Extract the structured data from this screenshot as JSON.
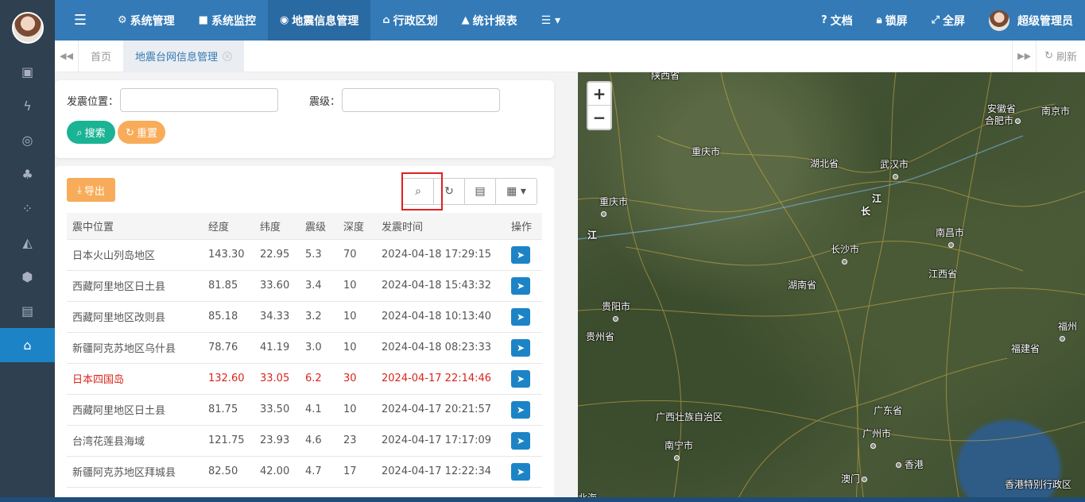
{
  "sidebar": {
    "icons": [
      "money-icon",
      "bolt-icon",
      "circle-dot-icon",
      "tree-icon",
      "grid-dots-icon",
      "area-chart-icon",
      "cube-icon",
      "newspaper-icon",
      "bank-icon"
    ]
  },
  "topnav": {
    "items": [
      {
        "icon": "⚙",
        "label": "系统管理"
      },
      {
        "icon": "■",
        "label": "系统监控"
      },
      {
        "icon": "◉",
        "label": "地震信息管理"
      },
      {
        "icon": "⌂",
        "label": "行政区划"
      },
      {
        "icon": "▲",
        "label": "统计报表"
      }
    ],
    "more_icon": "☰ ▾",
    "docs": "文档",
    "lock": "锁屏",
    "fullscreen": "全屏",
    "user": "超级管理员"
  },
  "tabs": {
    "home": "首页",
    "current": "地震台网信息管理",
    "refresh": "刷新"
  },
  "search": {
    "location_label": "发震位置：",
    "location_value": "",
    "magnitude_label": "震级：",
    "magnitude_value": "",
    "search_btn": "搜索",
    "reset_btn": "重置"
  },
  "table": {
    "export_btn": "导出",
    "columns": [
      "震中位置",
      "经度",
      "纬度",
      "震级",
      "深度",
      "发震时间",
      "操作"
    ],
    "rows": [
      {
        "location": "日本火山列岛地区",
        "lon": "143.30",
        "lat": "22.95",
        "mag": "5.3",
        "depth": "70",
        "time": "2024-04-18 17:29:15"
      },
      {
        "location": "西藏阿里地区日土县",
        "lon": "81.85",
        "lat": "33.60",
        "mag": "3.4",
        "depth": "10",
        "time": "2024-04-18 15:43:32"
      },
      {
        "location": "西藏阿里地区改则县",
        "lon": "85.18",
        "lat": "34.33",
        "mag": "3.2",
        "depth": "10",
        "time": "2024-04-18 10:13:40"
      },
      {
        "location": "新疆阿克苏地区乌什县",
        "lon": "78.76",
        "lat": "41.19",
        "mag": "3.0",
        "depth": "10",
        "time": "2024-04-18 08:23:33"
      },
      {
        "location": "日本四国岛",
        "lon": "132.60",
        "lat": "33.05",
        "mag": "6.2",
        "depth": "30",
        "time": "2024-04-17 22:14:46"
      },
      {
        "location": "西藏阿里地区日土县",
        "lon": "81.75",
        "lat": "33.50",
        "mag": "4.1",
        "depth": "10",
        "time": "2024-04-17 20:21:57"
      },
      {
        "location": "台湾花莲县海域",
        "lon": "121.75",
        "lat": "23.93",
        "mag": "4.6",
        "depth": "23",
        "time": "2024-04-17 17:17:09"
      },
      {
        "location": "新疆阿克苏地区拜城县",
        "lon": "82.50",
        "lat": "42.00",
        "mag": "4.7",
        "depth": "17",
        "time": "2024-04-17 12:22:34"
      }
    ],
    "highlight_color": "#d9251d"
  },
  "map": {
    "places": [
      "陕西省",
      "安徽省",
      "合肥市",
      "南京市",
      "重庆市",
      "湖北省",
      "武汉市",
      "江",
      "长",
      "重庆市",
      "江",
      "南昌市",
      "长沙市",
      "江西省",
      "湖南省",
      "贵阳市",
      "贵州省",
      "福州",
      "福建省",
      "广东省",
      "广西壮族自治区",
      "广州市",
      "南宁市",
      "香港",
      "澳门",
      "香港特别行政区",
      "北海"
    ]
  }
}
